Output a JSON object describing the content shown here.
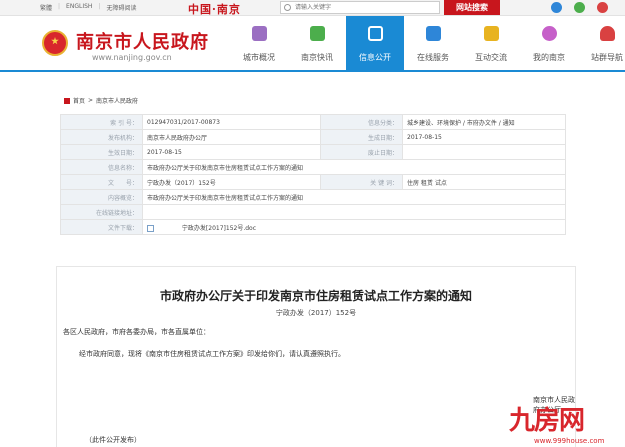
{
  "topbar": {
    "links": [
      "繁體",
      "ENGLISH",
      "无障碍阅读"
    ],
    "brand": "中国·南京",
    "search_placeholder": "请输入关键字",
    "search_button": "网站搜索"
  },
  "header": {
    "site_title": "南京市人民政府",
    "site_url": "www.nanjing.gov.cn",
    "nav": [
      {
        "label": "城市概况",
        "icon": "building-icon",
        "color": "#9b6fc2",
        "active": false
      },
      {
        "label": "南京快讯",
        "icon": "news-icon",
        "color": "#4cae4c",
        "active": false
      },
      {
        "label": "信息公开",
        "icon": "document-pen-icon",
        "color": "#ffffff",
        "active": true
      },
      {
        "label": "在线服务",
        "icon": "thumbs-up-icon",
        "color": "#2e86d8",
        "active": false
      },
      {
        "label": "互动交流",
        "icon": "chat-icon",
        "color": "#e8b320",
        "active": false
      },
      {
        "label": "我的南京",
        "icon": "flower-icon",
        "color": "#c660c9",
        "active": false
      },
      {
        "label": "站群导航",
        "icon": "person-icon",
        "color": "#d94141",
        "active": false
      }
    ]
  },
  "breadcrumb": [
    "首页",
    "南京市人民政府"
  ],
  "info": {
    "rows": [
      {
        "l1": "索 引 号：",
        "v1": "012947031/2017-00873",
        "l2": "信息分类：",
        "v2": "城乡建设、环境保护 / 市府办文件 / 通知"
      },
      {
        "l1": "发布机构：",
        "v1": "南京市人民政府办公厅",
        "l2": "生成日期：",
        "v2": "2017-08-15"
      },
      {
        "l1": "生效日期：",
        "v1": "2017-08-15",
        "l2": "废止日期：",
        "v2": ""
      }
    ],
    "name_label": "信息名称：",
    "name_value": "市政府办公厅关于印发南京市住房租赁试点工作方案的通知",
    "docno_label": "文　　号：",
    "docno_value": "宁政办发（2017）152号",
    "keywords_label": "关 键 词：",
    "keywords_value": "住房 租赁 试点",
    "content_label": "内容概览：",
    "content_value": "市政府办公厅关于印发南京市住房租赁试点工作方案的通知",
    "online_label": "在线链接地址：",
    "online_value": "",
    "download_label": "文件下载：",
    "download_value": "宁政办发[2017]152号.doc"
  },
  "document": {
    "title": "市政府办公厅关于印发南京市住房租赁试点工作方案的通知",
    "number": "宁政办发（2017）152号",
    "salutation": "各区人民政府，市府各委办局，市各直属单位：",
    "body": "经市政府同意，现将《南京市住房租赁试点工作方案》印发给你们，请认真遵照执行。",
    "signature": "南京市人民政府办公厅",
    "footer": "（此件公开发布）"
  },
  "watermark": {
    "main": "九房网",
    "url": "www.999house.com"
  }
}
